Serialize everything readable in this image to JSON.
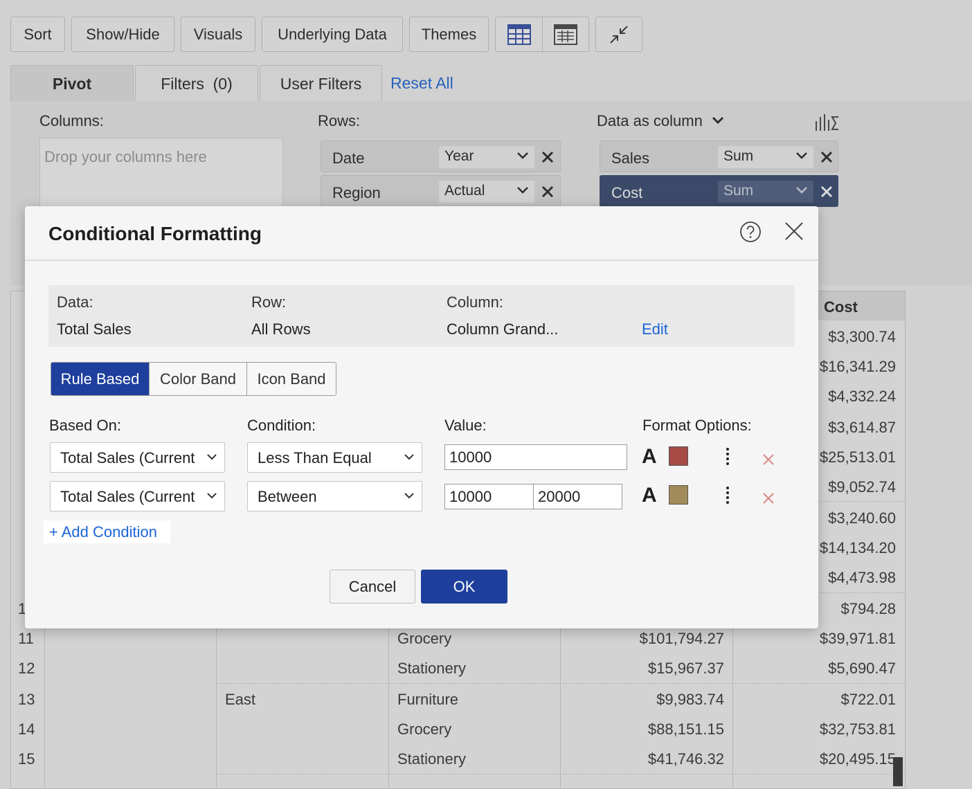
{
  "toolbar": {
    "buttons": [
      "Sort",
      "Show/Hide",
      "Visuals",
      "Underlying Data",
      "Themes"
    ],
    "icons": [
      "table-view-icon",
      "calendar-table-icon",
      "collapse-icon"
    ]
  },
  "tabs": {
    "pivot": "Pivot",
    "filters": "Filters  (0)",
    "user_filters": "User Filters",
    "reset_all": "Reset All"
  },
  "pivot": {
    "columns_label": "Columns:",
    "columns_placeholder": "Drop your columns here",
    "rows_label": "Rows:",
    "rows": [
      {
        "name": "Date",
        "agg": "Year"
      },
      {
        "name": "Region",
        "agg": "Actual"
      }
    ],
    "data_label": "Data as column",
    "data": [
      {
        "name": "Sales",
        "agg": "Sum"
      },
      {
        "name": "Cost",
        "agg": "Sum"
      }
    ]
  },
  "table": {
    "cost_header": "Cost",
    "cost_values_hidden_rows": [
      "$3,300.74",
      "$16,341.29",
      "$4,332.24",
      "$3,614.87",
      "$25,513.01",
      "$9,052.74",
      "$3,240.60",
      "$14,134.20",
      "$4,473.98",
      "$794.28"
    ],
    "partial_row_number": "1",
    "rows": [
      {
        "num": "11",
        "region": "",
        "category": "Grocery",
        "sales": "$101,794.27",
        "cost": "$39,971.81"
      },
      {
        "num": "12",
        "region": "",
        "category": "Stationery",
        "sales": "$15,967.37",
        "cost": "$5,690.47"
      },
      {
        "num": "13",
        "region": "East",
        "category": "Furniture",
        "sales": "$9,983.74",
        "cost": "$722.01"
      },
      {
        "num": "14",
        "region": "",
        "category": "Grocery",
        "sales": "$88,151.15",
        "cost": "$32,753.81"
      },
      {
        "num": "15",
        "region": "",
        "category": "Stationery",
        "sales": "$41,746.32",
        "cost": "$20,495.15"
      }
    ]
  },
  "dialog": {
    "title": "Conditional Formatting",
    "info": {
      "data_label": "Data:",
      "data_value": "Total Sales",
      "row_label": "Row:",
      "row_value": "All Rows",
      "column_label": "Column:",
      "column_value": "Column Grand...",
      "edit": "Edit"
    },
    "modes": [
      "Rule Based",
      "Color Band",
      "Icon Band"
    ],
    "active_mode": "Rule Based",
    "headers": {
      "based_on": "Based On:",
      "condition": "Condition:",
      "value": "Value:",
      "format": "Format Options:"
    },
    "conditions": [
      {
        "based_on": "Total Sales (Current",
        "condition": "Less Than Equal",
        "value": "10000",
        "value2": null,
        "format_glyph": "A",
        "color": "#a54a44"
      },
      {
        "based_on": "Total Sales (Current",
        "condition": "Between",
        "value": "10000",
        "value2": "20000",
        "format_glyph": "A",
        "color": "#a28b5a"
      }
    ],
    "add_condition": "+ Add Condition",
    "cancel": "Cancel",
    "ok": "OK"
  },
  "colors": {
    "accent": "#1e3f9c",
    "link": "#1b64d8",
    "delete": "#d98a86"
  }
}
